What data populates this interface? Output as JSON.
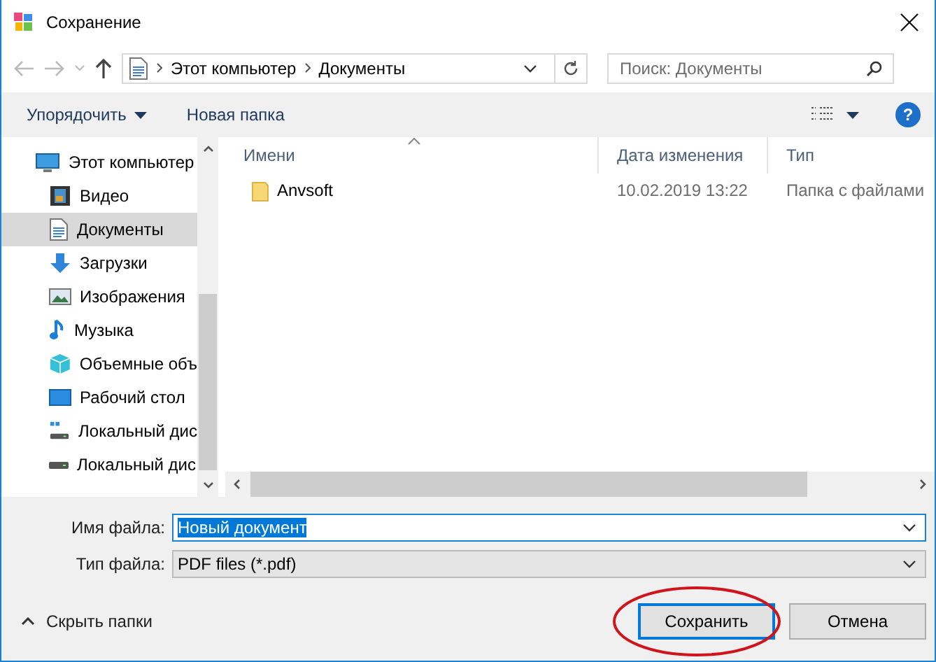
{
  "window": {
    "title": "Сохранение"
  },
  "address": {
    "crumbs": [
      "Этот компьютер",
      "Документы"
    ]
  },
  "search": {
    "placeholder": "Поиск: Документы"
  },
  "toolbar": {
    "organize": "Упорядочить",
    "new_folder": "Новая папка"
  },
  "sidebar": {
    "items": [
      {
        "label": "Этот компьютер",
        "selected": false,
        "children": [
          {
            "label": "Видео",
            "selected": false
          },
          {
            "label": "Документы",
            "selected": true
          },
          {
            "label": "Загрузки",
            "selected": false
          },
          {
            "label": "Изображения",
            "selected": false
          },
          {
            "label": "Музыка",
            "selected": false
          },
          {
            "label": "Объемные объ",
            "selected": false
          },
          {
            "label": "Рабочий стол",
            "selected": false
          },
          {
            "label": "Локальный дис",
            "selected": false
          },
          {
            "label": "Локальный дис",
            "selected": false
          }
        ]
      }
    ]
  },
  "table": {
    "columns": [
      "Имени",
      "Дата изменения",
      "Тип"
    ],
    "rows": [
      {
        "name": "Anvsoft",
        "date": "10.02.2019 13:22",
        "type": "Папка с файлами"
      }
    ]
  },
  "file_name": {
    "label": "Имя файла:",
    "value": "Новый документ",
    "value_selected": true
  },
  "file_type": {
    "label": "Тип файла:",
    "value": "PDF files (*.pdf)"
  },
  "hide_folders": "Скрыть папки",
  "help": "?",
  "buttons": [
    {
      "label": "Сохранить",
      "default": true,
      "highlighted": true
    },
    {
      "label": "Отмена",
      "default": false,
      "highlighted": false
    }
  ]
}
